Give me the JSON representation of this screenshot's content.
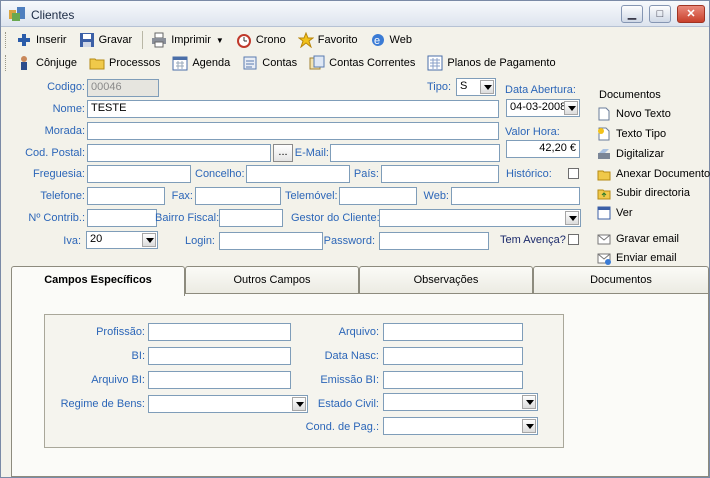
{
  "window": {
    "title": "Clientes"
  },
  "toolbar1": {
    "inserir": "Inserir",
    "gravar": "Gravar",
    "imprimir": "Imprimir",
    "crono": "Crono",
    "favorito": "Favorito",
    "web": "Web"
  },
  "toolbar2": {
    "conjuge": "Cônjuge",
    "processos": "Processos",
    "agenda": "Agenda",
    "contas": "Contas",
    "contas_correntes": "Contas Correntes",
    "planos": "Planos de Pagamento"
  },
  "form": {
    "codigo_label": "Codigo:",
    "codigo_value": "00046",
    "tipo_label": "Tipo:",
    "tipo_value": "S",
    "data_abertura_label": "Data Abertura:",
    "data_abertura_value": "04-03-2008",
    "nome_label": "Nome:",
    "nome_value": "TESTE",
    "morada_label": "Morada:",
    "valor_hora_label": "Valor Hora:",
    "valor_hora_value": "42,20 €",
    "cod_postal_label": "Cod. Postal:",
    "dots_label": "...",
    "email_label": "E-Mail:",
    "freguesia_label": "Freguesia:",
    "concelho_label": "Concelho:",
    "pais_label": "País:",
    "historico_label": "Histórico:",
    "telefone_label": "Telefone:",
    "fax_label": "Fax:",
    "telemovel_label": "Telemóvel:",
    "web_label": "Web:",
    "contrib_label": "Nº Contrib.:",
    "bairro_label": "Bairro Fiscal:",
    "gestor_label": "Gestor do Cliente:",
    "iva_label": "Iva:",
    "iva_value": "20",
    "login_label": "Login:",
    "password_label": "Password:",
    "avenca_label": "Tem Avença?"
  },
  "side": {
    "heading": "Documentos",
    "items": [
      "Novo Texto",
      "Texto Tipo",
      "Digitalizar",
      "Anexar Documento",
      "Subir directoria",
      "Ver",
      "Gravar email",
      "Enviar email"
    ]
  },
  "tabs": [
    "Campos Específicos",
    "Outros Campos",
    "Observações",
    "Documentos"
  ],
  "panel": {
    "profissao_label": "Profissão:",
    "bi_label": "BI:",
    "arquivo_bi_label": "Arquivo BI:",
    "regime_label": "Regime de Bens:",
    "arquivo_label": "Arquivo:",
    "data_nasc_label": "Data Nasc:",
    "emissao_bi_label": "Emissão BI:",
    "estado_civil_label": "Estado Civil:",
    "cond_pag_label": "Cond. de Pag.:"
  }
}
